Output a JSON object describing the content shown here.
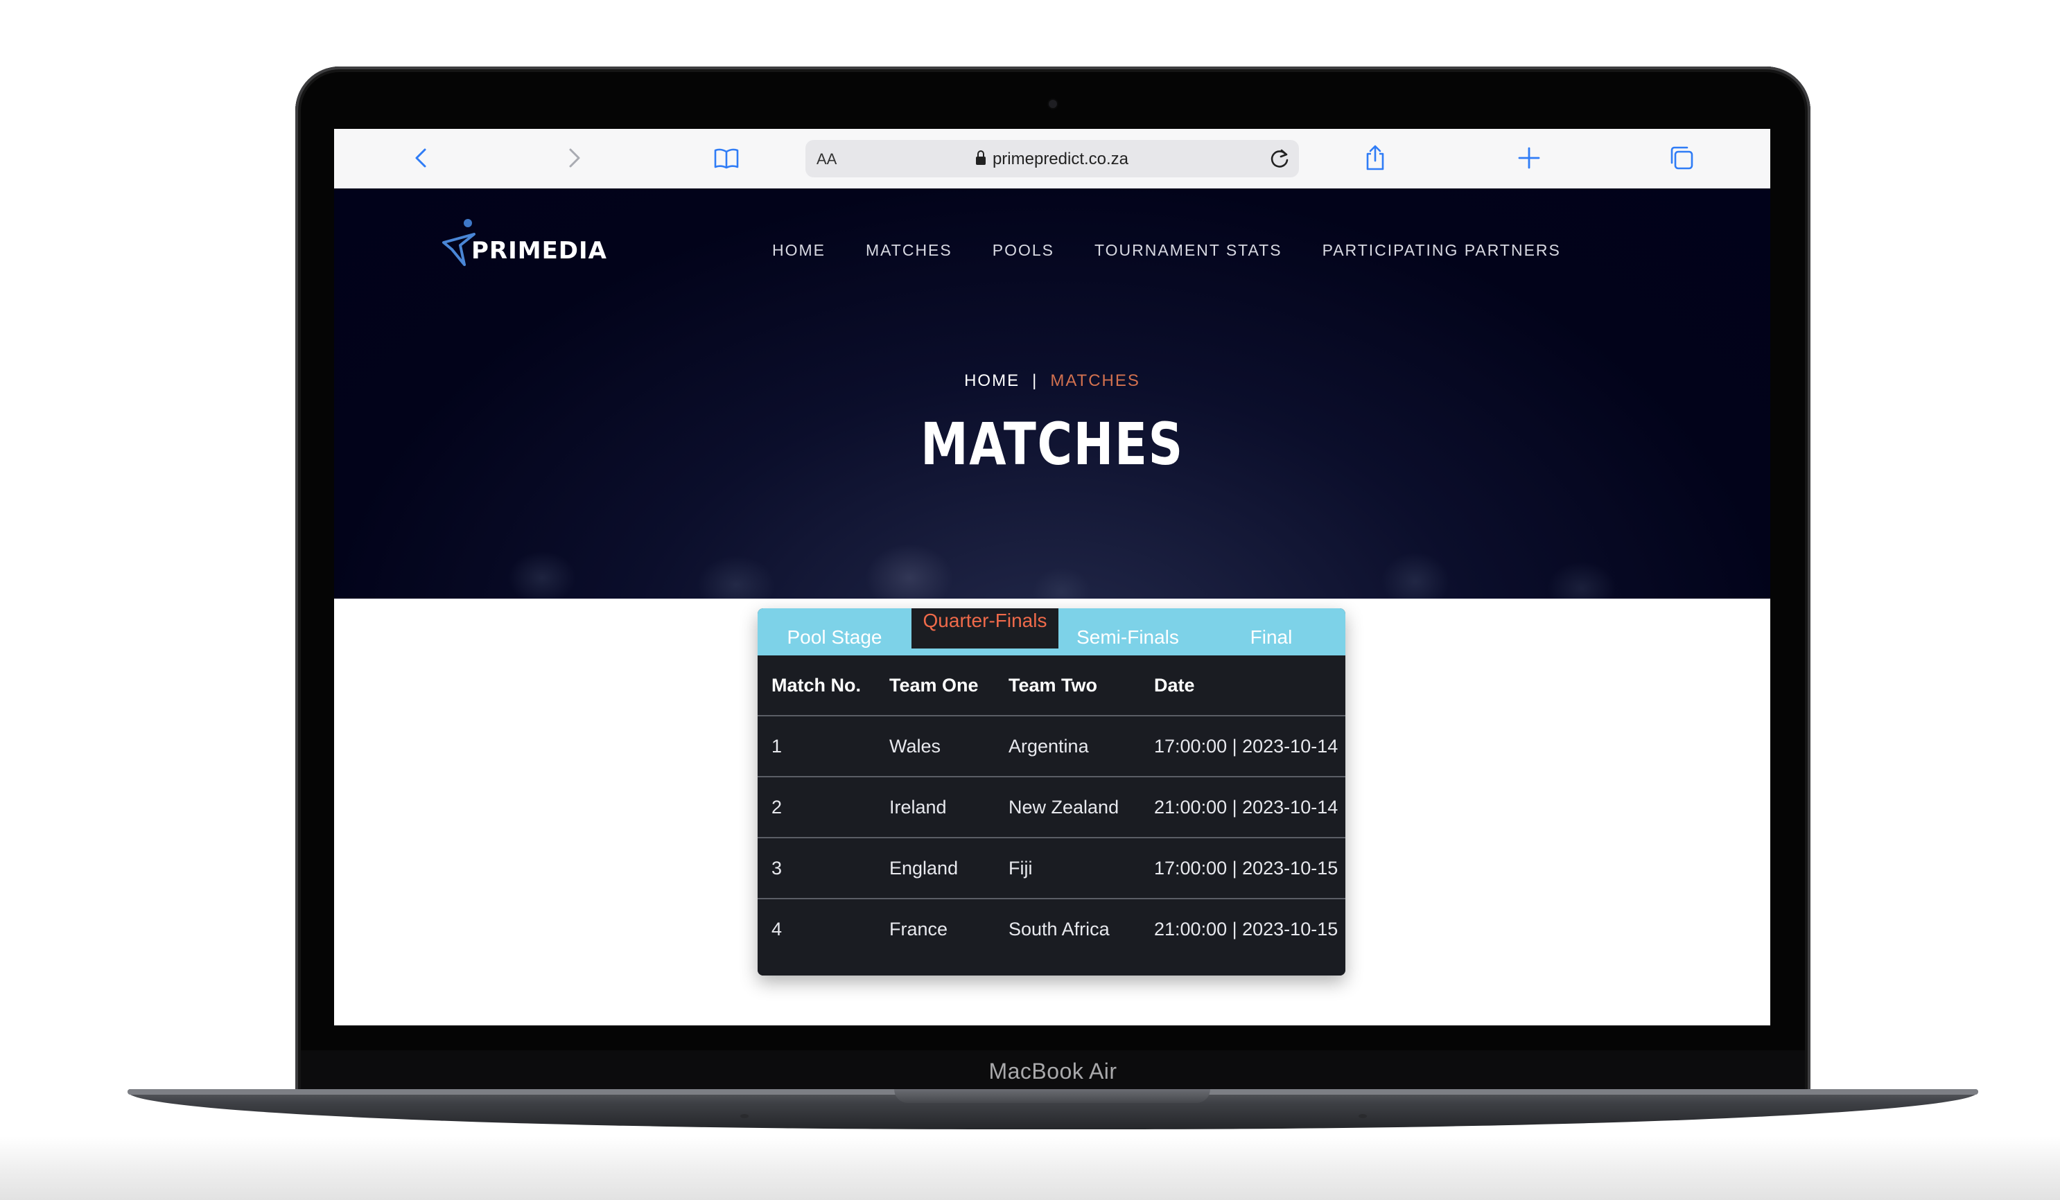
{
  "device": {
    "label": "MacBook Air"
  },
  "browser": {
    "aa_label": "AA",
    "url": "primepredict.co.za",
    "accent": "#2f7cf6"
  },
  "site": {
    "logo_text": "PRIMEDIA",
    "nav": [
      "HOME",
      "MATCHES",
      "POOLS",
      "TOURNAMENT STATS",
      "PARTICIPATING PARTNERS"
    ],
    "breadcrumb": {
      "home": "HOME",
      "separator": "|",
      "current": "MATCHES"
    },
    "page_title": "MATCHES",
    "colors": {
      "hero_bg": "#02031a",
      "accent_orange": "#ef6a4a",
      "tab_bar": "#7dd2e8",
      "table_bg": "#1a1c22"
    }
  },
  "matches": {
    "tabs": [
      "Pool Stage",
      "Quarter-Finals",
      "Semi-Finals",
      "Final"
    ],
    "active_tab": "Quarter-Finals",
    "columns": [
      "Match No.",
      "Team One",
      "Team Two",
      "Date"
    ],
    "rows": [
      [
        "1",
        "Wales",
        "Argentina",
        "17:00:00 | 2023-10-14"
      ],
      [
        "2",
        "Ireland",
        "New Zealand",
        "21:00:00 | 2023-10-14"
      ],
      [
        "3",
        "England",
        "Fiji",
        "17:00:00 | 2023-10-15"
      ],
      [
        "4",
        "France",
        "South Africa",
        "21:00:00 | 2023-10-15"
      ]
    ]
  }
}
